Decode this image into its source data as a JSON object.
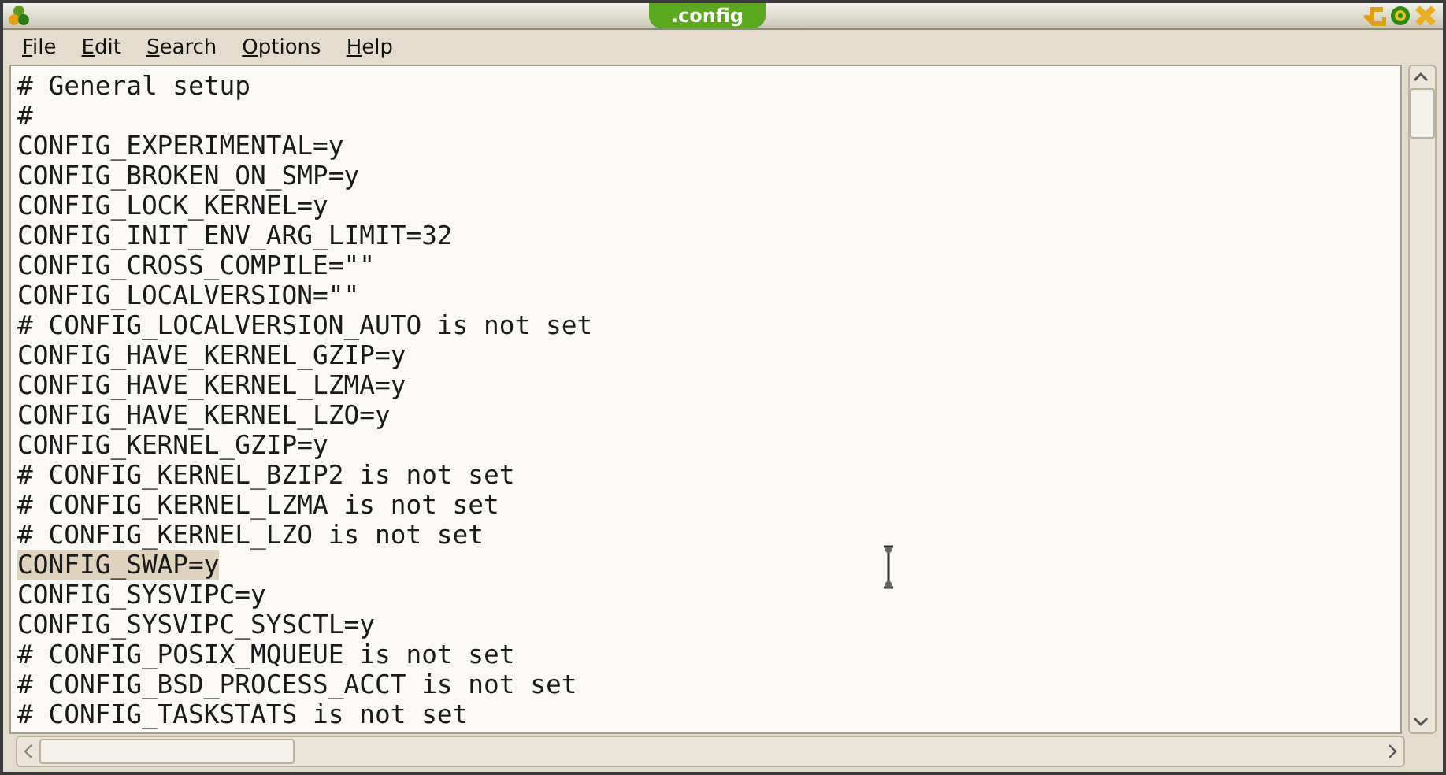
{
  "window": {
    "title": ".config"
  },
  "menu": [
    {
      "mnemonic": "F",
      "rest": "ile"
    },
    {
      "mnemonic": "E",
      "rest": "dit"
    },
    {
      "mnemonic": "S",
      "rest": "earch"
    },
    {
      "mnemonic": "O",
      "rest": "ptions"
    },
    {
      "mnemonic": "H",
      "rest": "elp"
    }
  ],
  "lines": [
    {
      "text": "# General setup",
      "selected": false
    },
    {
      "text": "#",
      "selected": false
    },
    {
      "text": "CONFIG_EXPERIMENTAL=y",
      "selected": false
    },
    {
      "text": "CONFIG_BROKEN_ON_SMP=y",
      "selected": false
    },
    {
      "text": "CONFIG_LOCK_KERNEL=y",
      "selected": false
    },
    {
      "text": "CONFIG_INIT_ENV_ARG_LIMIT=32",
      "selected": false
    },
    {
      "text": "CONFIG_CROSS_COMPILE=\"\"",
      "selected": false
    },
    {
      "text": "CONFIG_LOCALVERSION=\"\"",
      "selected": false
    },
    {
      "text": "# CONFIG_LOCALVERSION_AUTO is not set",
      "selected": false
    },
    {
      "text": "CONFIG_HAVE_KERNEL_GZIP=y",
      "selected": false
    },
    {
      "text": "CONFIG_HAVE_KERNEL_LZMA=y",
      "selected": false
    },
    {
      "text": "CONFIG_HAVE_KERNEL_LZO=y",
      "selected": false
    },
    {
      "text": "CONFIG_KERNEL_GZIP=y",
      "selected": false
    },
    {
      "text": "# CONFIG_KERNEL_BZIP2 is not set",
      "selected": false
    },
    {
      "text": "# CONFIG_KERNEL_LZMA is not set",
      "selected": false
    },
    {
      "text": "# CONFIG_KERNEL_LZO is not set",
      "selected": false
    },
    {
      "text": "CONFIG_SWAP=y",
      "selected": true
    },
    {
      "text": "CONFIG_SYSVIPC=y",
      "selected": false
    },
    {
      "text": "CONFIG_SYSVIPC_SYSCTL=y",
      "selected": false
    },
    {
      "text": "# CONFIG_POSIX_MQUEUE is not set",
      "selected": false
    },
    {
      "text": "# CONFIG_BSD_PROCESS_ACCT is not set",
      "selected": false
    },
    {
      "text": "# CONFIG_TASKSTATS is not set",
      "selected": false
    }
  ]
}
